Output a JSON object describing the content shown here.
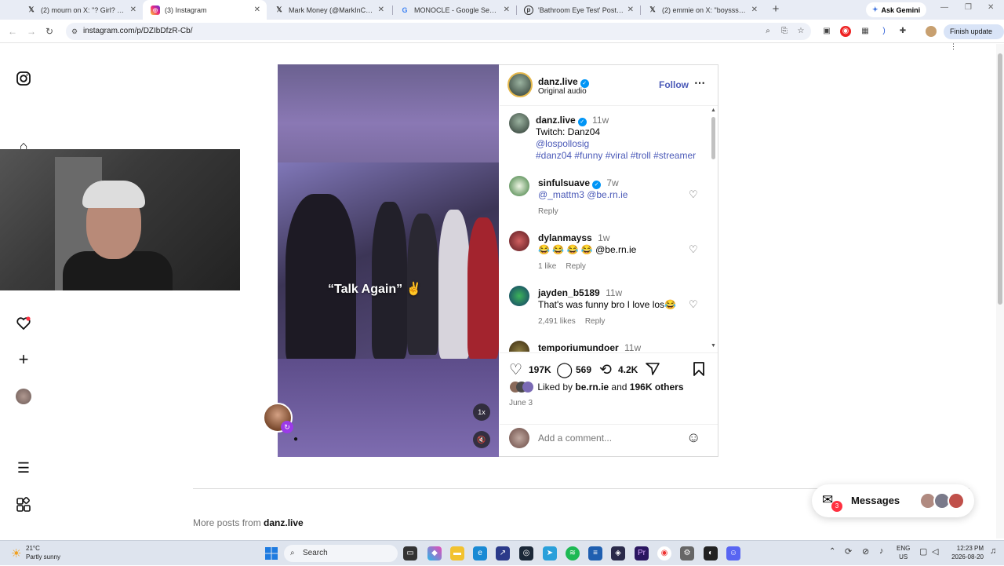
{
  "browser": {
    "tabs": [
      {
        "title": "(2) mourn on X: \"? Girl? https://",
        "icon": "x-logo",
        "active": false
      },
      {
        "title": "(3) Instagram",
        "icon": "instagram-logo",
        "active": true
      },
      {
        "title": "Mark Money (@MarkInCAD) / X",
        "icon": "x-logo",
        "active": false
      },
      {
        "title": "MONOCLE - Google Search",
        "icon": "google-logo",
        "active": false
      },
      {
        "title": "'Bathroom Eye Test' Poster, pict",
        "icon": "pinterest-logo",
        "active": false
      },
      {
        "title": "(2) emmie on X: \"boyssss? http",
        "icon": "x-logo",
        "active": false
      }
    ],
    "ask_gemini": "Ask Gemini",
    "url": "instagram.com/p/DZIbDfzR-Cb/",
    "finish_update": "Finish update"
  },
  "post": {
    "author": "danz.live",
    "audio": "Original audio",
    "follow": "Follow",
    "video_caption": "“Talk Again”",
    "speed_badge": "1x",
    "caption": {
      "user": "danz.live",
      "time": "11w",
      "line1": "Twitch: Danz04",
      "mention": "@lospollosig",
      "hashtags": "#danz04 #funny #viral #troll #streamer"
    },
    "comments": [
      {
        "user": "sinfulsuave",
        "verified": true,
        "time": "7w",
        "text": "@_mattm3 @be.rn.ie",
        "likes": "",
        "reply": "Reply"
      },
      {
        "user": "dylanmayss",
        "verified": false,
        "time": "1w",
        "text": "😂 😂 😂 😂 @be.rn.ie",
        "likes": "1 like",
        "reply": "Reply"
      },
      {
        "user": "jayden_b5189",
        "verified": false,
        "time": "11w",
        "text": "That's was funny bro I love los😂",
        "likes": "2,491 likes",
        "reply": "Reply"
      },
      {
        "user": "temporiumundoer",
        "verified": false,
        "time": "11w",
        "text": "",
        "likes": "",
        "reply": ""
      }
    ],
    "like_count": "197K",
    "comment_count": "569",
    "repost_count": "4.2K",
    "liked_by_prefix": "Liked by",
    "liked_by_user": "be.rn.ie",
    "liked_by_and": "and",
    "liked_by_others": "196K others",
    "date": "June 3",
    "add_comment_placeholder": "Add a comment..."
  },
  "more_posts_prefix": "More posts from",
  "more_posts_user": "danz.live",
  "messages": {
    "label": "Messages",
    "badge": "3"
  },
  "taskbar": {
    "weather_temp": "21°C",
    "weather_text": "Partly sunny",
    "search": "Search",
    "lang_1": "ENG",
    "lang_2": "US",
    "time": "12:23 PM",
    "date": "2026-08-20"
  },
  "colors": {
    "accent": "#0095f6",
    "link": "#4b5ab8",
    "follow": "#4b5ab8",
    "notification": "#ff3040"
  }
}
